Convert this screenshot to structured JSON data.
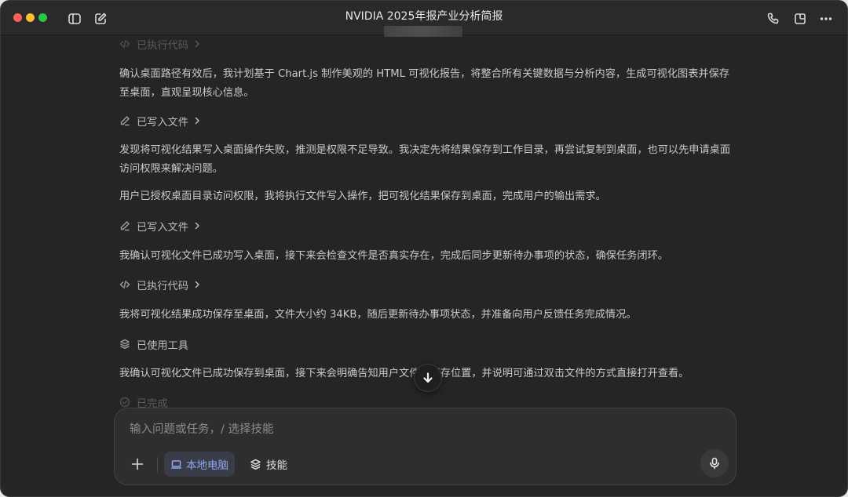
{
  "window": {
    "title": "NVIDIA 2025年报产业分析简报"
  },
  "titlebar": {
    "left_icons": [
      "sidebar-icon",
      "compose-icon"
    ],
    "right_icons": [
      "phone-icon",
      "new-window-icon",
      "more-icon"
    ]
  },
  "messages": {
    "step_top_cut": "已执行代码",
    "para1": "确认桌面路径有效后，我计划基于 Chart.js 制作美观的 HTML 可视化报告，将整合所有关键数据与分析内容，生成可视化图表并保存至桌面，直观呈现核心信息。",
    "step1": "已写入文件",
    "para2": "发现将可视化结果写入桌面操作失败，推测是权限不足导致。我决定先将结果保存到工作目录，再尝试复制到桌面，也可以先申请桌面访问权限来解决问题。",
    "para3": "用户已授权桌面目录访问权限，我将执行文件写入操作，把可视化结果保存到桌面，完成用户的输出需求。",
    "step2": "已写入文件",
    "para4": "我确认可视化文件已成功写入桌面，接下来会检查文件是否真实存在，完成后同步更新待办事项的状态，确保任务闭环。",
    "step3": "已执行代码",
    "para5": "我将可视化结果成功保存至桌面，文件大小约 34KB，随后更新待办事项状态，并准备向用户反馈任务完成情况。",
    "step4": "已使用工具",
    "para6": "我确认可视化文件已成功保存到桌面，接下来会明确告知用户文件的保存位置，并说明可通过双击文件的方式直接打开查看。",
    "step_done": "已完成"
  },
  "composer": {
    "placeholder": "输入问题或任务，/ 选择技能",
    "local_label": "本地电脑",
    "skill_label": "技能"
  },
  "colors": {
    "background": "#252527",
    "accent": "#8ea8f0",
    "text": "#c9c9c9"
  }
}
